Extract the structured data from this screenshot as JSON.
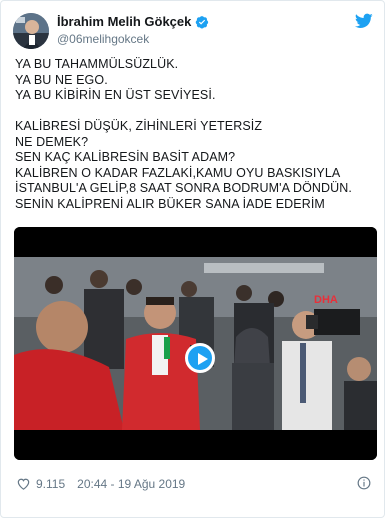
{
  "user": {
    "display_name": "İbrahim Melih Gökçek",
    "handle": "@06melihgokcek",
    "verified": true
  },
  "tweet": {
    "lines": [
      "YA BU TAHAMMÜLSÜZLÜK.",
      "YA BU NE EGO.",
      "YA BU KİBİRİN EN ÜST SEVİYESİ.",
      "",
      "KALİBRESİ DÜŞÜK, ZİHİNLERİ YETERSİZ",
      "NE DEMEK?",
      "SEN KAÇ KALİBRESİN BASİT ADAM?",
      "KALİBREN O KADAR FAZLAKİ,KAMU OYU BASKISIYLA",
      "İSTANBUL'A GELİP,8 SAAT SONRA BODRUM'A DÖNDÜN.",
      "SENİN KALİPRENİ ALIR BÜKER SANA İADE EDERİM"
    ]
  },
  "media": {
    "watermark": "DHA",
    "type": "video"
  },
  "footer": {
    "likes": "9.115",
    "timestamp": "20:44 - 19 Ağu 2019"
  },
  "colors": {
    "accent": "#1da1f2",
    "like_red": "#e0245e",
    "secondary_text": "#657786"
  },
  "icons": {
    "verified": "verified-badge-icon",
    "brand": "twitter-bird-icon",
    "like": "heart-icon",
    "info": "info-icon"
  }
}
